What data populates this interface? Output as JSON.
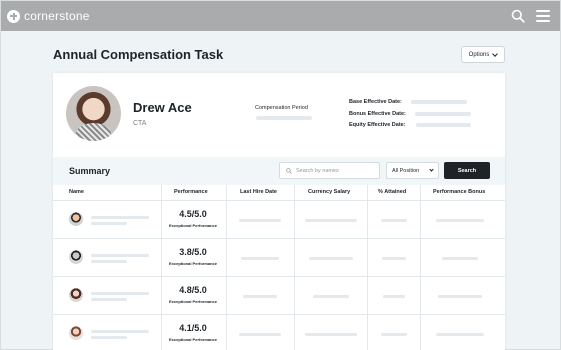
{
  "app": {
    "brand": "cornerstone"
  },
  "header": {
    "title": "Annual Compensation Task",
    "options_label": "Options"
  },
  "employee": {
    "name": "Drew Ace",
    "role": "CTA",
    "compensation_period_label": "Compensation Period",
    "base_effective_label": "Base Effective Date:",
    "bonus_effective_label": "Bonus Effective Date:",
    "equity_effective_label": "Equity Effective Date:"
  },
  "summary": {
    "title": "Summary",
    "search_placeholder": "Search by names",
    "position_filter": "All Position",
    "search_button": "Search"
  },
  "table": {
    "columns": [
      "Name",
      "Performance",
      "Last Hire Date",
      "Currency Salary",
      "% Attained",
      "Performance Bonus"
    ],
    "rows": [
      {
        "score": "4.5/5.0",
        "rating": "Exceptional Performance"
      },
      {
        "score": "3.8/5.0",
        "rating": "Exceptional Performance"
      },
      {
        "score": "4.8/5.0",
        "rating": "Exceptional Performance"
      },
      {
        "score": "4.1/5.0",
        "rating": "Exceptional Performance"
      }
    ]
  },
  "colors": {
    "topbar": "#a9abac",
    "page_bg": "#eef4f6",
    "button_dark": "#1f2327",
    "skeleton": "#e3e9ec"
  },
  "icons": [
    "logo-icon",
    "search-icon",
    "menu-icon",
    "chevron-down-icon",
    "search-icon"
  ]
}
